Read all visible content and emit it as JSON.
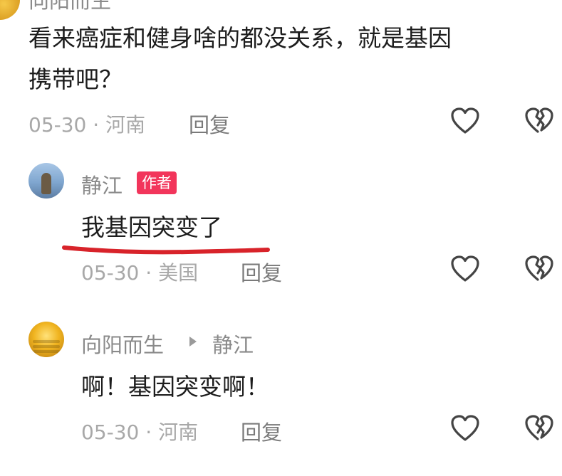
{
  "top_comment": {
    "author_partial": "向阳而生",
    "text_line1": "看来癌症和健身啥的都没关系，就是基因",
    "text_line2": "携带吧？",
    "date": "05-30",
    "sep": "·",
    "location": "河南",
    "reply_label": "回复"
  },
  "reply1": {
    "author": "静江",
    "badge": "作者",
    "text": "我基因突变了",
    "date": "05-30",
    "sep": "·",
    "location": "美国",
    "reply_label": "回复"
  },
  "reply2": {
    "author": "向阳而生",
    "reply_to": "静江",
    "text": "啊！基因突变啊！",
    "date": "05-30",
    "sep": "·",
    "location": "河南",
    "reply_label": "回复"
  },
  "colors": {
    "badge_bg": "#f2355b",
    "underline": "#d8232a",
    "icon_stroke": "#444444"
  },
  "icons": {
    "like": "heart-icon",
    "dislike": "broken-heart-icon"
  }
}
